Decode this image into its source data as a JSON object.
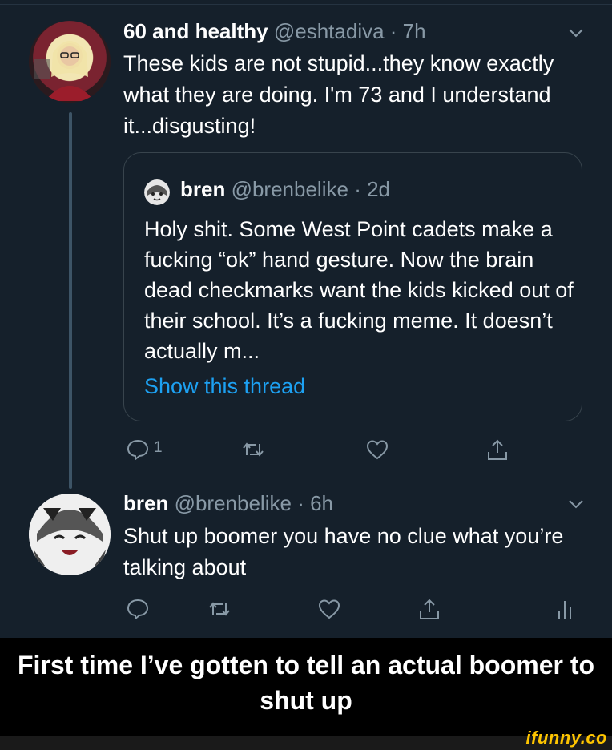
{
  "tweet1": {
    "name": "60 and healthy",
    "handle": "@eshtadiva",
    "time": "· 7h",
    "text": "These kids are not stupid...they know exactly what they are doing. I'm 73 and I understand it...disgusting!"
  },
  "quoted": {
    "name": "bren",
    "handle": "@brenbelike",
    "time": "· 2d",
    "text": "Holy shit. Some West Point cadets make a fucking “ok” hand gesture. Now the brain dead checkmarks want the kids kicked out of their school. It’s a fucking meme. It doesn’t actually m...",
    "link": "Show this thread"
  },
  "tweet1_actions": {
    "reply_count": "1"
  },
  "tweet2": {
    "name": "bren",
    "handle": "@brenbelike",
    "time": "· 6h",
    "text": "Shut up boomer you have no clue what you’re talking about"
  },
  "caption": "First time I’ve gotten to tell an actual boomer to shut up",
  "watermark": "ifunny.co",
  "colors": {
    "background": "#15202b",
    "secondary_text": "#8899a6",
    "link": "#1da1f2",
    "border": "#38444d",
    "watermark": "#fec500"
  },
  "icons": [
    "chevron-down-icon",
    "reply-icon",
    "retweet-icon",
    "like-icon",
    "share-icon",
    "analytics-icon"
  ]
}
